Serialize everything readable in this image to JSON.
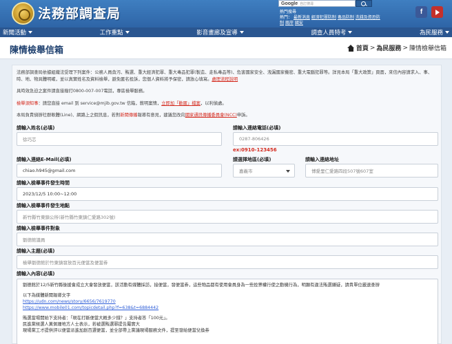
{
  "site": {
    "name": "法務部調查局"
  },
  "search": {
    "brand": "Google",
    "brand_suffix": "自訂搜尋",
    "placeholder": "搜尋條件"
  },
  "hot": {
    "title": "熱門搜尋",
    "label": "熱門：",
    "keywords_1": [
      "最新消息",
      "經濟犯罪防制",
      "毒品防制",
      "洗錢及資恐防",
      "制"
    ],
    "keywords_2": [
      "兩岸",
      "國安"
    ]
  },
  "social": {
    "facebook": "f"
  },
  "nav": [
    "新聞活動",
    "工作重點",
    "影音畫廊及宣導",
    "調查人員特考",
    "為民服務"
  ],
  "page": {
    "title": "陳情檢舉信箱"
  },
  "breadcrumb": {
    "home": "首頁",
    "sep": ">",
    "parent": "為民服務",
    "current": "陳情檢舉信箱"
  },
  "intro": {
    "p1": "法務部調查局依據組織法受理下列案件：公務人員貪污、賄選、重大經濟犯罪、重大毒品犯罪(製造、走私毒品等)、危害國家安全、洩漏國家機密、重大電腦犯罪等。詳見本局「重大政策」頁面，來信內容請求入、事、時、地、物具體明確，並以真實姓名及資料檢舉，避免匿名投訴，您個人資料將予保密，請放心填寫。",
    "p1_link": "處理流程說明",
    "p2": "具時效急迫之案件請直接撥打0800-007-007電話，專區檢舉服務。",
    "p3_red": "檢舉須知事",
    "p3_a": "：請您直接 email 到 service@mjib.gov.tw 信箱，敘明案情，",
    "p3_red2": "立即加「勸匿」檔案",
    "p3_b": "，以利偵處。",
    "p4_a": "本局負責偵辦社群軟體(Line)、網路上之假訊息，若對",
    "p4_red": "新聞傳播",
    "p4_b": "報導有意見，建議您改向",
    "p4_red2": "國家通訊傳播委員會(NCC)",
    "p4_c": "申訴。"
  },
  "form": {
    "name_label": "請輸入姓名(必填)",
    "name_value": "徐巧芯",
    "phone_label": "請輸入連絡電話(必填)",
    "phone_value": "0287-806426",
    "phone_hint": "ex:0910-123456",
    "email_label": "請輸入連絡E-Mail(必填)",
    "email_value": "chiao.h945@gmail.com",
    "region_label": "請選擇地區(必填)",
    "region_value": "嘉義市",
    "address_label": "請輸入連絡地址",
    "address_value": "博愛里仁愛路四段507號607室",
    "time_label": "請輸入檢舉事件發生時間",
    "time_value": "2023/12/5 10:00~12:00",
    "place_label": "請輸入檢舉事件發生地點",
    "place_value": "新竹縣竹東鎮公所(新竹縣竹東鎮仁愛路302號)",
    "target_label": "請輸入檢舉事件對象",
    "target_value": "劉德館議員",
    "subject_label": "請輸入主題(必填)",
    "subject_value": "檢舉劉德館於竹東鎮發放百元便當及便當券",
    "content_label": "請輸入內容(必填)",
    "content_lines": [
      "劉德館於12/5新竹縣後援會成立大會發放便當，該活動有媒體採訪，接便當，發便當券，這些物品都有使用會員身為一些投票權行使之動機行為，明顯有違法賄選嫌疑，請貴單位嚴速查辦",
      "以下為媒體新聞報導文字",
      "https://udn.com/news/story/6656/7619770",
      "https://www.mobile01.com/topicdetail.php?f=638&t=6884442",
      "賄選當場開始下支持者：「現在打斷便當大概多少錢？」支持者答「100元」。",
      "民進黨候選人黃佩珊地方人士表示，若被選賄選罪提告屬實大",
      "現場黨工才提供評以便當派進加創百選便當，並全部帶上黨議現場服務文件，提至發給便當兌換券"
    ]
  }
}
